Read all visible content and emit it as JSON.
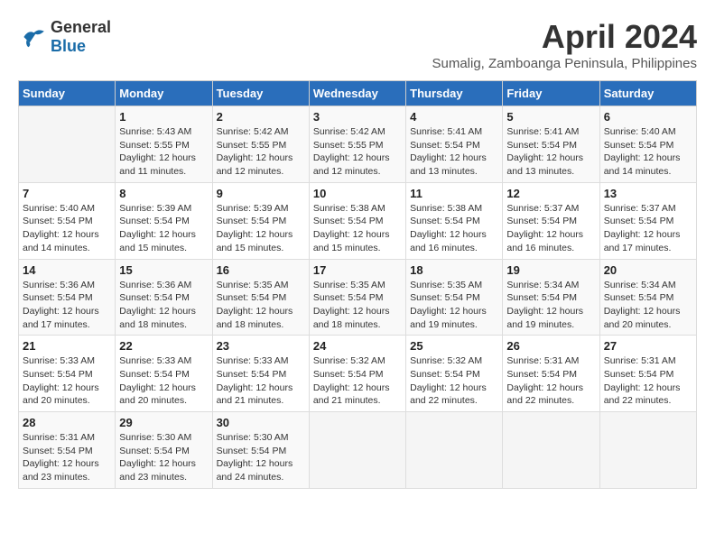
{
  "header": {
    "logo_general": "General",
    "logo_blue": "Blue",
    "month_year": "April 2024",
    "subtitle": "Sumalig, Zamboanga Peninsula, Philippines"
  },
  "columns": [
    "Sunday",
    "Monday",
    "Tuesday",
    "Wednesday",
    "Thursday",
    "Friday",
    "Saturday"
  ],
  "weeks": [
    [
      {
        "day": "",
        "info": ""
      },
      {
        "day": "1",
        "info": "Sunrise: 5:43 AM\nSunset: 5:55 PM\nDaylight: 12 hours\nand 11 minutes."
      },
      {
        "day": "2",
        "info": "Sunrise: 5:42 AM\nSunset: 5:55 PM\nDaylight: 12 hours\nand 12 minutes."
      },
      {
        "day": "3",
        "info": "Sunrise: 5:42 AM\nSunset: 5:55 PM\nDaylight: 12 hours\nand 12 minutes."
      },
      {
        "day": "4",
        "info": "Sunrise: 5:41 AM\nSunset: 5:54 PM\nDaylight: 12 hours\nand 13 minutes."
      },
      {
        "day": "5",
        "info": "Sunrise: 5:41 AM\nSunset: 5:54 PM\nDaylight: 12 hours\nand 13 minutes."
      },
      {
        "day": "6",
        "info": "Sunrise: 5:40 AM\nSunset: 5:54 PM\nDaylight: 12 hours\nand 14 minutes."
      }
    ],
    [
      {
        "day": "7",
        "info": "Sunrise: 5:40 AM\nSunset: 5:54 PM\nDaylight: 12 hours\nand 14 minutes."
      },
      {
        "day": "8",
        "info": "Sunrise: 5:39 AM\nSunset: 5:54 PM\nDaylight: 12 hours\nand 15 minutes."
      },
      {
        "day": "9",
        "info": "Sunrise: 5:39 AM\nSunset: 5:54 PM\nDaylight: 12 hours\nand 15 minutes."
      },
      {
        "day": "10",
        "info": "Sunrise: 5:38 AM\nSunset: 5:54 PM\nDaylight: 12 hours\nand 15 minutes."
      },
      {
        "day": "11",
        "info": "Sunrise: 5:38 AM\nSunset: 5:54 PM\nDaylight: 12 hours\nand 16 minutes."
      },
      {
        "day": "12",
        "info": "Sunrise: 5:37 AM\nSunset: 5:54 PM\nDaylight: 12 hours\nand 16 minutes."
      },
      {
        "day": "13",
        "info": "Sunrise: 5:37 AM\nSunset: 5:54 PM\nDaylight: 12 hours\nand 17 minutes."
      }
    ],
    [
      {
        "day": "14",
        "info": "Sunrise: 5:36 AM\nSunset: 5:54 PM\nDaylight: 12 hours\nand 17 minutes."
      },
      {
        "day": "15",
        "info": "Sunrise: 5:36 AM\nSunset: 5:54 PM\nDaylight: 12 hours\nand 18 minutes."
      },
      {
        "day": "16",
        "info": "Sunrise: 5:35 AM\nSunset: 5:54 PM\nDaylight: 12 hours\nand 18 minutes."
      },
      {
        "day": "17",
        "info": "Sunrise: 5:35 AM\nSunset: 5:54 PM\nDaylight: 12 hours\nand 18 minutes."
      },
      {
        "day": "18",
        "info": "Sunrise: 5:35 AM\nSunset: 5:54 PM\nDaylight: 12 hours\nand 19 minutes."
      },
      {
        "day": "19",
        "info": "Sunrise: 5:34 AM\nSunset: 5:54 PM\nDaylight: 12 hours\nand 19 minutes."
      },
      {
        "day": "20",
        "info": "Sunrise: 5:34 AM\nSunset: 5:54 PM\nDaylight: 12 hours\nand 20 minutes."
      }
    ],
    [
      {
        "day": "21",
        "info": "Sunrise: 5:33 AM\nSunset: 5:54 PM\nDaylight: 12 hours\nand 20 minutes."
      },
      {
        "day": "22",
        "info": "Sunrise: 5:33 AM\nSunset: 5:54 PM\nDaylight: 12 hours\nand 20 minutes."
      },
      {
        "day": "23",
        "info": "Sunrise: 5:33 AM\nSunset: 5:54 PM\nDaylight: 12 hours\nand 21 minutes."
      },
      {
        "day": "24",
        "info": "Sunrise: 5:32 AM\nSunset: 5:54 PM\nDaylight: 12 hours\nand 21 minutes."
      },
      {
        "day": "25",
        "info": "Sunrise: 5:32 AM\nSunset: 5:54 PM\nDaylight: 12 hours\nand 22 minutes."
      },
      {
        "day": "26",
        "info": "Sunrise: 5:31 AM\nSunset: 5:54 PM\nDaylight: 12 hours\nand 22 minutes."
      },
      {
        "day": "27",
        "info": "Sunrise: 5:31 AM\nSunset: 5:54 PM\nDaylight: 12 hours\nand 22 minutes."
      }
    ],
    [
      {
        "day": "28",
        "info": "Sunrise: 5:31 AM\nSunset: 5:54 PM\nDaylight: 12 hours\nand 23 minutes."
      },
      {
        "day": "29",
        "info": "Sunrise: 5:30 AM\nSunset: 5:54 PM\nDaylight: 12 hours\nand 23 minutes."
      },
      {
        "day": "30",
        "info": "Sunrise: 5:30 AM\nSunset: 5:54 PM\nDaylight: 12 hours\nand 24 minutes."
      },
      {
        "day": "",
        "info": ""
      },
      {
        "day": "",
        "info": ""
      },
      {
        "day": "",
        "info": ""
      },
      {
        "day": "",
        "info": ""
      }
    ]
  ]
}
